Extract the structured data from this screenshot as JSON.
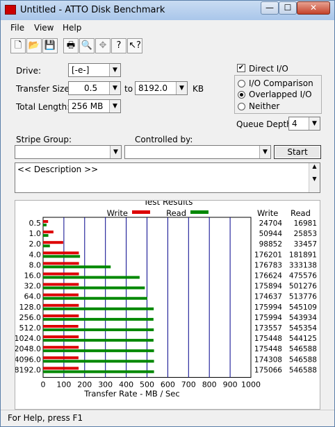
{
  "window": {
    "title": "Untitled - ATTO Disk Benchmark",
    "min": "—",
    "max": "☐",
    "close": "✕"
  },
  "menu": [
    "File",
    "View",
    "Help"
  ],
  "toolbar": [
    "new",
    "open",
    "save",
    "print",
    "print-preview",
    "move",
    "help",
    "context-help"
  ],
  "form": {
    "drive_label": "Drive:",
    "drive_value": "[-e-]",
    "transfer_label": "Transfer Size:",
    "transfer_from": "0.5",
    "to_label": "to",
    "transfer_to": "8192.0",
    "kb_label": "KB",
    "total_label": "Total Length:",
    "total_value": "256 MB",
    "direct_io_label": "Direct I/O",
    "io_comparison_label": "I/O Comparison",
    "overlapped_label": "Overlapped I/O",
    "neither_label": "Neither",
    "queue_label": "Queue Depth:",
    "queue_value": "4",
    "stripe_label": "Stripe Group:",
    "controlled_label": "Controlled by:",
    "start_label": "Start",
    "description": "<< Description >>"
  },
  "results": {
    "title": "Test Results",
    "legend_write": "Write",
    "legend_read": "Read",
    "col_write": "Write",
    "col_read": "Read",
    "colors": {
      "write": "#dd0000",
      "read": "#008800",
      "grid": "#00008b"
    }
  },
  "chart_data": {
    "type": "bar",
    "title": "Test Results",
    "xlabel": "Transfer Rate - MB / Sec",
    "xlim": [
      0,
      1000
    ],
    "xticks": [
      "0",
      "100",
      "200",
      "300",
      "400",
      "500",
      "600",
      "700",
      "800",
      "900",
      "1000"
    ],
    "categories": [
      "0.5",
      "1.0",
      "2.0",
      "4.0",
      "8.0",
      "16.0",
      "32.0",
      "64.0",
      "128.0",
      "256.0",
      "512.0",
      "1024.0",
      "2048.0",
      "4096.0",
      "8192.0"
    ],
    "series": [
      {
        "name": "Write",
        "values": [
          24704,
          50944,
          98852,
          176201,
          176783,
          176624,
          175894,
          174637,
          175994,
          175994,
          173557,
          175448,
          175448,
          174308,
          175066
        ]
      },
      {
        "name": "Read",
        "values": [
          16981,
          25853,
          33457,
          181891,
          333138,
          475576,
          501276,
          513776,
          545109,
          543934,
          545354,
          544125,
          546588,
          546588,
          546588
        ]
      }
    ]
  },
  "status": {
    "text": "For Help, press F1"
  }
}
